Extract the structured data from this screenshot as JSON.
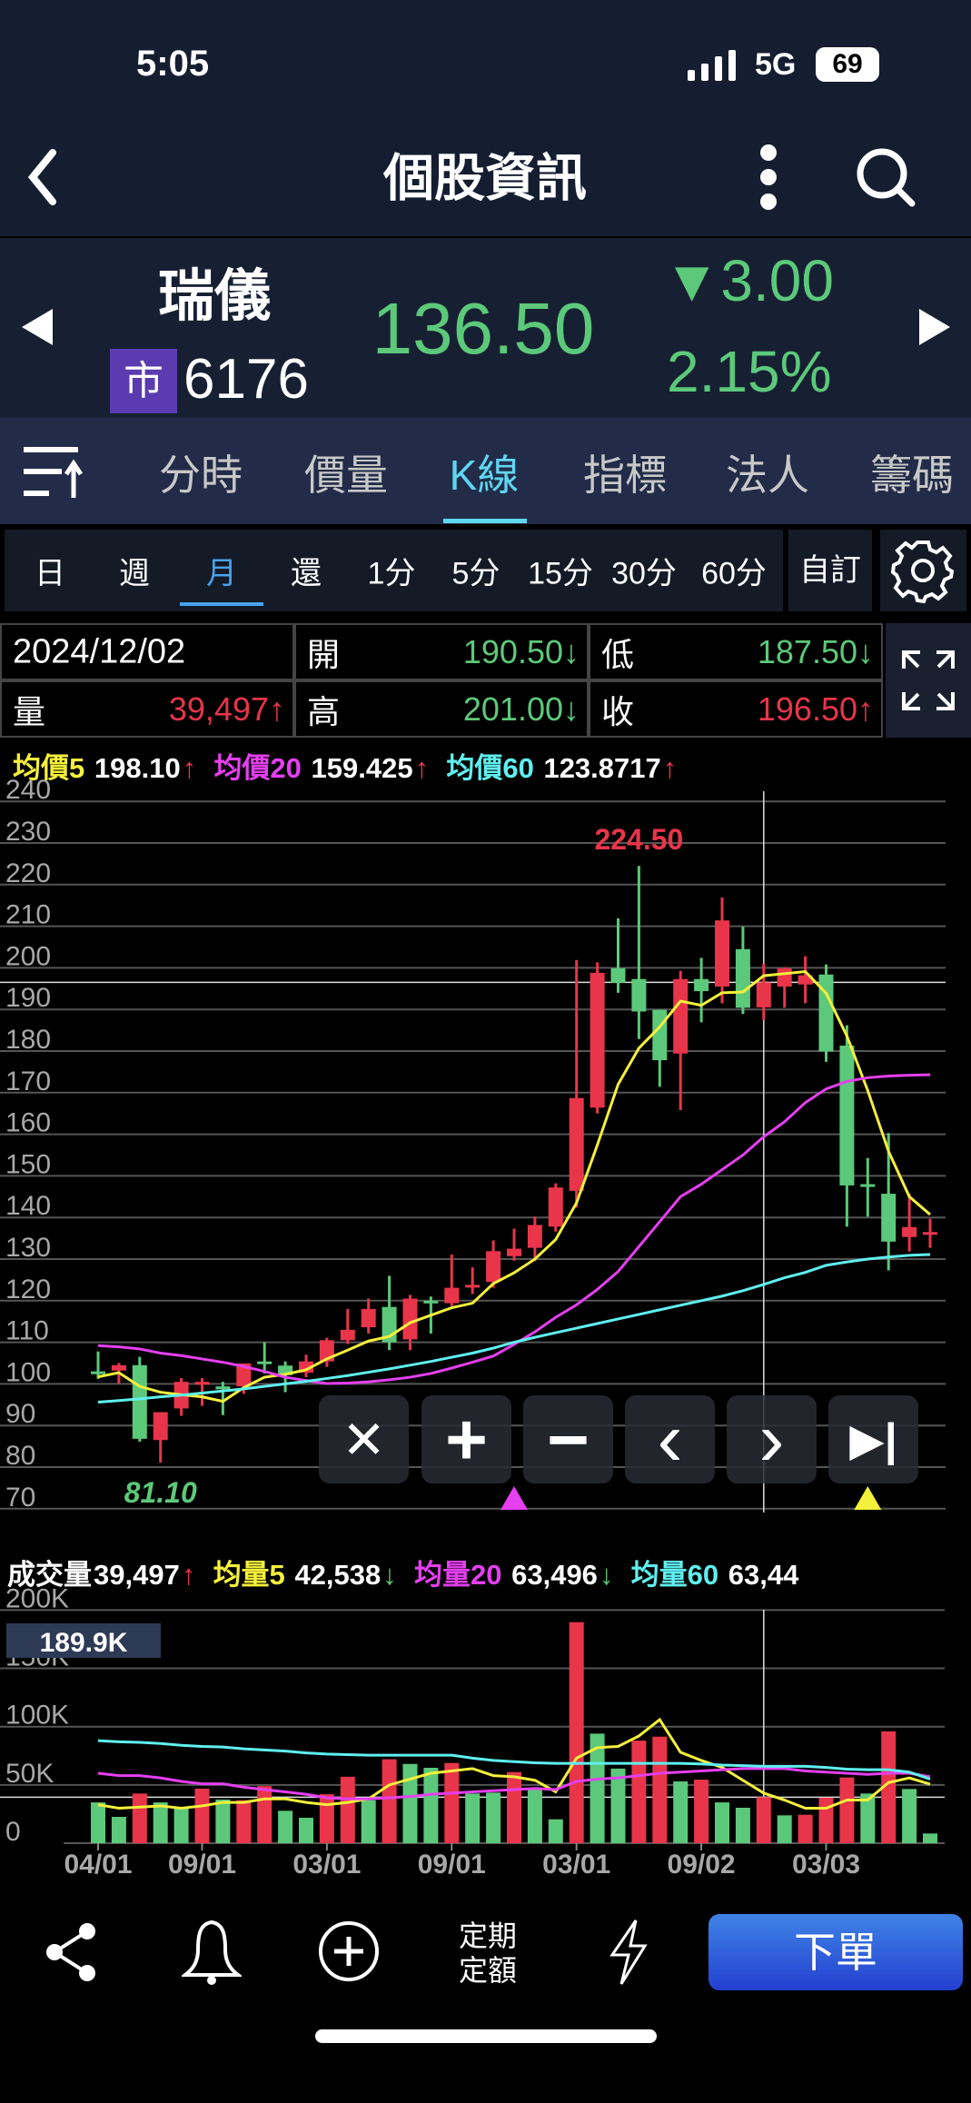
{
  "status_bar": {
    "time": "5:05",
    "network": "5G",
    "battery": "69"
  },
  "header": {
    "title": "個股資訊"
  },
  "stock": {
    "name": "瑞儀",
    "market_badge": "市",
    "code": "6176",
    "price": "136.50",
    "change": "▼3.00",
    "change_pct": "2.15%"
  },
  "tabs": [
    {
      "label": "分時"
    },
    {
      "label": "價量"
    },
    {
      "label": "K線",
      "active": true
    },
    {
      "label": "指標"
    },
    {
      "label": "法人"
    },
    {
      "label": "籌碼"
    }
  ],
  "periods": [
    {
      "label": "日"
    },
    {
      "label": "週"
    },
    {
      "label": "月",
      "active": true
    },
    {
      "label": "還"
    },
    {
      "label": "1分"
    },
    {
      "label": "5分"
    },
    {
      "label": "15分"
    },
    {
      "label": "30分"
    },
    {
      "label": "60分"
    }
  ],
  "custom_label": "自訂",
  "ohlc": {
    "date": "2024/12/02",
    "volume_label": "量",
    "volume": "39,497↑",
    "open_label": "開",
    "open": "190.50↓",
    "high_label": "高",
    "high": "201.00↓",
    "low_label": "低",
    "low": "187.50↓",
    "close_label": "收",
    "close": "196.50↑"
  },
  "ma_legend": {
    "ma5_label": "均價5",
    "ma5": "198.10",
    "ma5_arrow": "↑",
    "ma20_label": "均價20",
    "ma20": "159.425",
    "ma20_arrow": "↑",
    "ma60_label": "均價60",
    "ma60": "123.8717",
    "ma60_arrow": "↑"
  },
  "vol_legend": {
    "vol_label": "成交量",
    "vol": "39,497",
    "vol_arrow": "↑",
    "mv5_label": "均量5",
    "mv5": "42,538",
    "mv5_arrow": "↓",
    "mv20_label": "均量20",
    "mv20": "63,496",
    "mv20_arrow": "↓",
    "mv60_label": "均量60",
    "mv60": "63,44"
  },
  "chart_controls": [
    "✕",
    "+",
    "−",
    "‹",
    "›",
    "▶|"
  ],
  "toolbar": {
    "dca_line1": "定期",
    "dca_line2": "定額",
    "order_label": "下單"
  },
  "colors": {
    "up": "#e8354a",
    "down": "#5cc97a",
    "ma5": "#f5f03a",
    "ma20": "#e53ff0",
    "ma60": "#5ff0f0",
    "order": "#2f5fe0"
  },
  "chart_data": [
    {
      "type": "candlestick",
      "title": "月K",
      "yticks": [
        240,
        230,
        220,
        210,
        200,
        190,
        180,
        170,
        160,
        150,
        140,
        130,
        120,
        110,
        100,
        90,
        80,
        70
      ],
      "ylim": [
        70,
        240
      ],
      "max_label": "224.50",
      "min_label": "81.10",
      "crosshair_index": 32,
      "crosshair_price": 196.5,
      "markers": [
        {
          "index": 20,
          "color": "#e53ff0"
        },
        {
          "index": 37,
          "color": "#f5f03a"
        }
      ],
      "ohlc": [
        [
          103.0,
          107.8,
          101.2,
          102.8
        ],
        [
          103.2,
          105.0,
          100.1,
          104.5
        ],
        [
          104.5,
          106.5,
          86.1,
          86.8
        ],
        [
          86.5,
          93.2,
          81.1,
          93.2
        ],
        [
          94.1,
          101.4,
          92.3,
          100.5
        ],
        [
          99.8,
          101.4,
          94.7,
          100.5
        ],
        [
          99.4,
          100.5,
          92.5,
          98.7
        ],
        [
          99.4,
          104.9,
          97.6,
          104.9
        ],
        [
          105.4,
          110.0,
          102.5,
          105.2
        ],
        [
          104.4,
          105.4,
          98.0,
          102.1
        ],
        [
          102.7,
          107.0,
          101.6,
          105.4
        ],
        [
          105.4,
          111.1,
          104.1,
          110.5
        ],
        [
          110.5,
          118.0,
          109.6,
          113.0
        ],
        [
          113.6,
          120.5,
          112.1,
          118.0
        ],
        [
          118.5,
          126.0,
          108.1,
          110.0
        ],
        [
          110.7,
          121.4,
          108.1,
          120.5
        ],
        [
          120.0,
          121.0,
          112.1,
          119.8
        ],
        [
          119.4,
          131.1,
          118.7,
          123.1
        ],
        [
          123.5,
          128.0,
          121.6,
          123.8
        ],
        [
          124.5,
          134.5,
          123.1,
          131.9
        ],
        [
          130.7,
          137.3,
          129.6,
          132.5
        ],
        [
          132.7,
          140.2,
          129.5,
          138.2
        ],
        [
          137.8,
          148.2,
          136.6,
          147.2
        ],
        [
          146.4,
          201.9,
          142.4,
          168.7
        ],
        [
          166.4,
          201.3,
          165.0,
          198.8
        ],
        [
          199.9,
          211.9,
          194.0,
          196.4
        ],
        [
          197.3,
          224.5,
          182.9,
          189.5
        ],
        [
          189.9,
          189.9,
          171.4,
          177.8
        ],
        [
          179.4,
          199.3,
          165.8,
          197.3
        ],
        [
          197.3,
          202.4,
          186.9,
          194.4
        ],
        [
          195.5,
          216.9,
          191.5,
          211.4
        ],
        [
          204.5,
          209.9,
          188.9,
          190.4
        ],
        [
          190.5,
          201.0,
          187.5,
          196.5
        ],
        [
          195.5,
          200.2,
          190.4,
          199.9
        ],
        [
          196.0,
          202.8,
          191.5,
          198.2
        ],
        [
          198.4,
          200.8,
          177.4,
          179.9
        ],
        [
          181.3,
          186.2,
          137.8,
          147.7
        ],
        [
          148.0,
          154.3,
          140.2,
          147.7
        ],
        [
          145.7,
          160.3,
          127.3,
          134.2
        ],
        [
          135.3,
          145.7,
          131.8,
          137.7
        ],
        [
          136.0,
          139.7,
          132.7,
          136.5
        ]
      ],
      "ma5": [
        101.7,
        102.7,
        99.4,
        98,
        97.4,
        96.9,
        95.8,
        99.1,
        101.6,
        102.3,
        103.4,
        106,
        108.1,
        110.3,
        111.4,
        114.7,
        116.5,
        118.3,
        119.4,
        124.1,
        126.7,
        130,
        134.7,
        143.5,
        157.4,
        172,
        180.7,
        185.8,
        192,
        191,
        194,
        194.2,
        198.1,
        198.6,
        199.1,
        193.9,
        183.6,
        170.5,
        155.9,
        145,
        140.7
      ],
      "ma20": [
        109.2,
        108.9,
        108.4,
        107.4,
        106.8,
        106,
        105.2,
        104.2,
        103,
        101.6,
        100.8,
        100.1,
        100.2,
        100.5,
        101,
        101.6,
        102.5,
        103.8,
        105.2,
        106.7,
        109.5,
        112.5,
        116,
        119,
        122.7,
        127,
        133,
        139,
        145,
        148,
        151.5,
        155,
        159.4,
        163,
        167.6,
        170.9,
        172.7,
        173.6,
        174,
        174.2,
        174.3
      ],
      "ma60": [
        95.6,
        96,
        96.4,
        96.9,
        97.3,
        97.8,
        98.3,
        98.8,
        99.4,
        100,
        100.6,
        101.3,
        102,
        102.8,
        103.6,
        104.5,
        105.4,
        106.4,
        107.4,
        108.6,
        110,
        111.2,
        112.3,
        113.4,
        114.5,
        115.6,
        116.7,
        117.8,
        118.9,
        120,
        121.1,
        122.4,
        123.9,
        125.5,
        126.8,
        128.5,
        129.3,
        130,
        130.5,
        130.9,
        131.1
      ]
    },
    {
      "type": "bar",
      "title": "成交量",
      "yticks": [
        "200K",
        "150K",
        "100K",
        "50K",
        "0"
      ],
      "ylim": [
        0,
        200
      ],
      "unit": "K",
      "crosshair_label": "189.9K",
      "crosshair_value": 39.5,
      "x_labels": [
        {
          "index": 0,
          "label": "04/01"
        },
        {
          "index": 5,
          "label": "09/01"
        },
        {
          "index": 11,
          "label": "03/01"
        },
        {
          "index": 17,
          "label": "09/01"
        },
        {
          "index": 23,
          "label": "03/01"
        },
        {
          "index": 29,
          "label": "09/02"
        },
        {
          "index": 35,
          "label": "03/03"
        }
      ],
      "values": [
        35,
        22.6,
        42.6,
        35,
        30.4,
        46.8,
        37.4,
        36.9,
        49,
        27.8,
        21.8,
        42,
        57,
        36.9,
        72,
        68,
        64.7,
        68.8,
        42.6,
        43.4,
        61,
        46.5,
        20.5,
        189.6,
        94,
        64,
        88,
        91.4,
        53,
        54.5,
        35,
        30.4,
        39.5,
        23.9,
        24.4,
        39,
        56.4,
        42.6,
        96,
        46.5,
        8.3
      ],
      "up": [
        0,
        0,
        1,
        0,
        0,
        1,
        0,
        1,
        1,
        0,
        0,
        1,
        1,
        0,
        1,
        0,
        0,
        1,
        0,
        0,
        1,
        0,
        0,
        1,
        0,
        0,
        1,
        1,
        0,
        1,
        0,
        0,
        1,
        0,
        1,
        1,
        1,
        0,
        1,
        0,
        0
      ],
      "ma5": [
        33,
        30,
        31,
        32,
        30,
        32,
        35,
        35,
        38,
        38,
        35,
        33,
        35,
        38,
        50,
        55,
        60,
        62,
        64,
        58,
        57,
        54,
        44,
        73,
        82,
        83,
        92,
        106,
        78,
        71,
        65,
        54,
        43,
        37,
        30,
        30,
        37,
        37,
        52,
        56,
        50.6
      ],
      "ma20": [
        60,
        58,
        58,
        56,
        53,
        51,
        51,
        48,
        46,
        44,
        42,
        39,
        38,
        38,
        39,
        40,
        42,
        43,
        44,
        45,
        46,
        47,
        46,
        53,
        55,
        56,
        58,
        60,
        61,
        62,
        63,
        64,
        64,
        64,
        62,
        61,
        60,
        59,
        60,
        60,
        57
      ],
      "ma60": [
        88,
        87,
        86.5,
        85.5,
        84,
        83,
        82.5,
        81,
        80,
        79,
        77.5,
        76.5,
        76,
        75.5,
        75.5,
        75.5,
        75.5,
        75.5,
        73,
        71,
        70,
        69,
        68.5,
        68.5,
        68.5,
        68.5,
        68.5,
        68.5,
        68.5,
        68,
        67,
        66.5,
        66,
        66,
        66,
        65,
        63.5,
        63,
        63,
        61,
        55
      ]
    }
  ]
}
